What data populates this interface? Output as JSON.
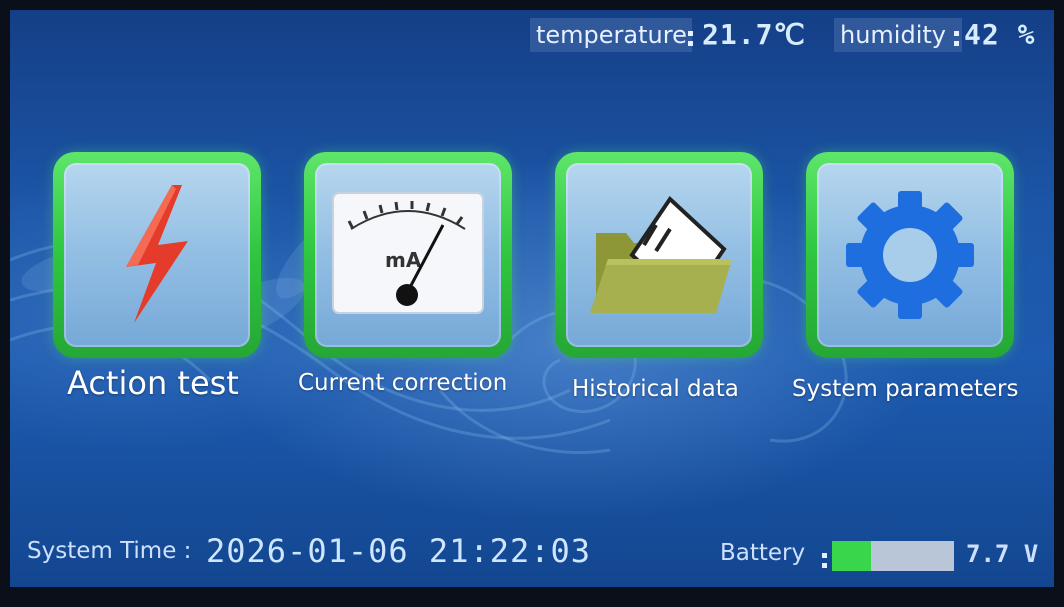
{
  "status": {
    "temperature_label": "temperature",
    "temperature_value": "21.7℃",
    "humidity_label": "humidity",
    "humidity_value": "42 %"
  },
  "menu": {
    "items": [
      {
        "label": "Action test",
        "icon": "lightning-bolt-icon"
      },
      {
        "label": "Current correction",
        "icon": "ammeter-gauge-icon",
        "gauge_unit": "mA"
      },
      {
        "label": "Historical data",
        "icon": "folder-icon"
      },
      {
        "label": "System parameters",
        "icon": "gear-icon"
      }
    ]
  },
  "footer": {
    "time_label": "System Time :",
    "time_value": "2026-01-06 21:22:03",
    "battery_label": "Battery",
    "battery_level": 0.32,
    "battery_voltage": "7.7 V"
  },
  "colors": {
    "accent_green": "#2fc640",
    "bolt_red": "#e43b2a",
    "gear_blue": "#1f6ee0",
    "folder_olive": "#a7b04e",
    "screen_blue": "#1c56a8"
  }
}
